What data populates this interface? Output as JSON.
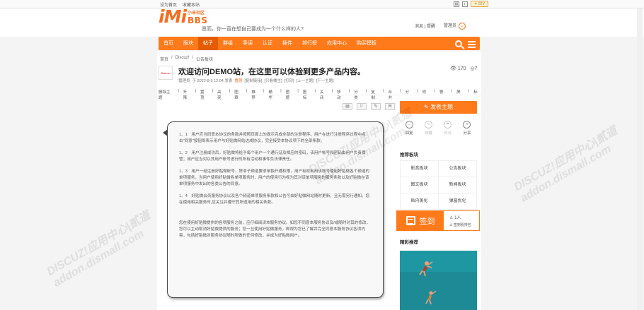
{
  "topbar": {
    "set_home": "设为首页",
    "bookmark": "收藏本站",
    "diy": "DIY"
  },
  "logo": {
    "mark": "iMi",
    "top": "小米社区",
    "bbs": "BBS"
  },
  "header": {
    "tagline": "愿而，你一直在想自己要成为一个什么样的人?",
    "messages": "消息",
    "reminders": "提醒",
    "admin": "管理员"
  },
  "nav": {
    "items": [
      "首页",
      "版块",
      "帖子",
      "群组",
      "导读",
      "认证",
      "插件",
      "排行榜",
      "应用中心",
      "购买模板"
    ],
    "active_index": 2
  },
  "breadcrumb": [
    "首页",
    "Discuz!",
    "公告板块"
  ],
  "thread": {
    "avatar_text": "Discuz!",
    "title": "欢迎访问DEMO站，在这里可以体验到更多产品内容。",
    "views": "170",
    "replies": "7",
    "meta": [
      "管理员",
      "于 2022-8-9 12:04 发表",
      "置顶",
      "[复制链接]",
      "[只看楼主]",
      "[打印]",
      "[上一主题]",
      "[下一主题]"
    ]
  },
  "mod_tools": [
    "删除主题",
    "升降",
    "置顶",
    "高亮",
    "图章",
    "推荐",
    "精华",
    "图题",
    "图标",
    "关闭",
    "移动",
    "分类",
    "复制",
    "合并",
    "分割",
    "修复",
    "警告",
    "屏蔽",
    "标签"
  ],
  "post": {
    "tool_icons": [
      "▤",
      "⚐",
      "✎",
      "✉"
    ],
    "paragraphs": [
      "1、1　用户应当同意本协议的条款并按照页面上的提示完成全部的注册程序。用户在进行注册程序过程中点击\"同意\"按钮即表示用户与好贴微网站达成协议，完全接受本协议项下的全部条款。",
      "1、2　用户注册成功后，好贴微将给予每个用户一个通行证及相应的密码，该用户帐号和密码由用户负责保管；用户应当对以其用户帐号进行的所有活动和事件负法律责任。",
      "1、3　用户一经注册好贴微帐号，除非子频道要求单独开通权限，用户有权利用该账号使用好贴微各个频道的单项服务，当用户使用好贴微各单项服务时，用户的使用行为视为其对该单项服务的服务条款以及好贴微在该单项服务中发出的各类公告的同意。",
      "1、4　好贴微会员服务协议以及各个频道单项服务条款和公告可由好贴微网站随时更新，且无需另行通知。您在使用相关服务时,应关注并遵守其所适用的相关条款。",
      "您在使用好贴微提供的各项服务之前，应仔细阅读本服务协议。如您不同意本服务协议及/或随时对其的修改，您可以主动取消好贴微提供的服务；您一旦使用好贴微服务，即视为您已了解并完全同意本服务协议各项内容，包括好贴微对服务协议随时所做的任何修改，并成为好贴微用户。"
    ]
  },
  "sidebar": {
    "post_button": "发表主题",
    "actions": [
      {
        "label": "回复",
        "icon": "…"
      },
      {
        "label": "收藏",
        "icon": "✎"
      },
      {
        "label": "评分",
        "icon": "⚑"
      },
      {
        "label": "分享",
        "icon": "<"
      }
    ],
    "recommend_title": "推荐板块",
    "recommend": [
      "影音板块",
      "公告板块",
      "图文板块",
      "新闻板块",
      "贴内美化",
      "弹窗优化"
    ],
    "signin": {
      "label": "签到",
      "count": "1人",
      "sub": "签到看排名"
    },
    "featured_title": "精彩推荐"
  },
  "watermark": {
    "line1": "DISCUZ!应用中心|贰道",
    "line2": "addon.dismall.com"
  },
  "colors": {
    "accent": "#ff7a1a",
    "brand": "#f26f21",
    "featured_bg": "#1d8a96"
  }
}
